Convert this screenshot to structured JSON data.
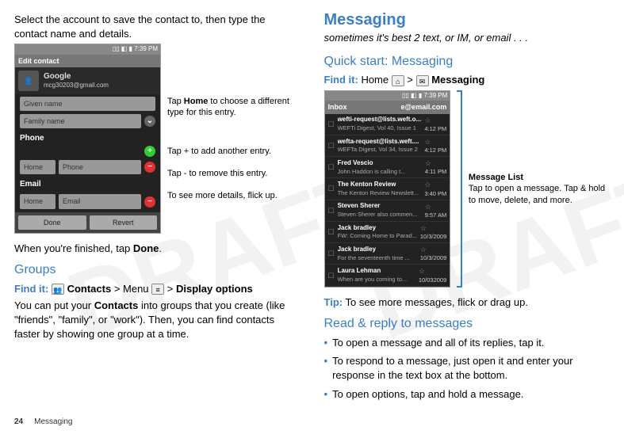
{
  "left": {
    "intro": "Select the account to save the contact to, then type the contact name and details.",
    "phone": {
      "status_time": "7:39 PM",
      "title": "Edit contact",
      "google_label": "Google",
      "google_sub": "mcg30203@gmail.com",
      "given": "Given name",
      "family": "Family name",
      "phone_label": "Phone",
      "home1": "Home",
      "phone_val": "Phone",
      "email_label": "Email",
      "home2": "Home",
      "email_val": "Email",
      "done": "Done",
      "revert": "Revert"
    },
    "annot": {
      "home": "Tap Home to choose a different type for this entry.",
      "plus": "Tap + to add another entry.",
      "minus": "Tap - to remove this entry.",
      "flick": "To see more details, flick up."
    },
    "after_phone": "When you're finished, tap Done.",
    "groups_title": "Groups",
    "groups_findit_label": "Find it:",
    "groups_findit_rest": " Contacts > Menu  > Display options",
    "groups_body": "You can put your Contacts into groups that you create (like \"friends\", \"family\", or \"work\"). Then, you can find contacts faster by showing one group at a time."
  },
  "right": {
    "messaging_title": "Messaging",
    "messaging_sub": "sometimes it's best 2 text, or IM, or email . . .",
    "quickstart_title": "Quick start: Messaging",
    "findit_label": "Find it:",
    "findit_rest": "Home  >  Messaging",
    "phone": {
      "status_time": "7:39 PM",
      "inbox_label": "Inbox",
      "inbox_email": "e@email.com"
    },
    "messages": [
      {
        "sender": "wefti-request@lists.weft.o...",
        "preview": "WEFTi Digest, Vol 40, Issue 1",
        "time": "4:12 PM"
      },
      {
        "sender": "wefta-request@lists.weft....",
        "preview": "WEFTa Digest, Vol 34, Issue 2",
        "time": "4:12 PM"
      },
      {
        "sender": "Fred Vescio",
        "preview": "John Haddon is calling t...",
        "time": "4:11 PM"
      },
      {
        "sender": "The Kenton Review",
        "preview": "The Kenton Review Newslett...",
        "time": "3:40 PM"
      },
      {
        "sender": "Steven Sherer",
        "preview": "Steven Sherer also commen...",
        "time": "9:57 AM"
      },
      {
        "sender": "Jack bradley",
        "preview": "FW: Coming Home to Parad...",
        "time": "10/3/2009"
      },
      {
        "sender": "Jack bradley",
        "preview": "For the seventeenth time ...",
        "time": "10/3/2009"
      },
      {
        "sender": "Laura Lehman",
        "preview": "When are you coming to...",
        "time": "10/032009"
      }
    ],
    "msglist_title": "Message List",
    "msglist_body": "Tap to open a message. Tap & hold to move, delete, and more.",
    "tip_label": "Tip:",
    "tip_body": " To see more messages, flick or drag up.",
    "read_title": "Read & reply to messages",
    "bullets": [
      "To open a message and all of its replies, tap it.",
      "To respond to a message, just open it and enter your response in the text box at the bottom.",
      "To open options, tap and hold a message."
    ]
  },
  "footer": {
    "page": "24",
    "section": "Messaging"
  }
}
